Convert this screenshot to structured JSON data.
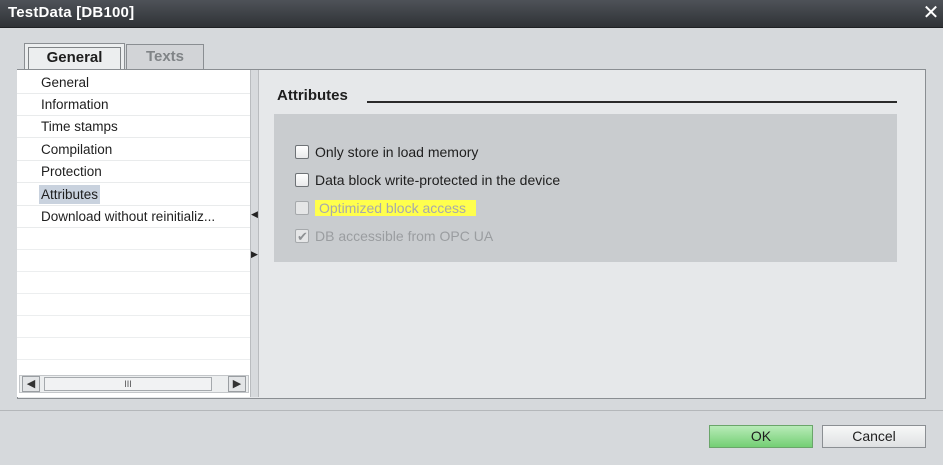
{
  "window": {
    "title": "TestData [DB100]",
    "close_icon": "close-icon"
  },
  "tabs": [
    {
      "label": "General",
      "active": true
    },
    {
      "label": "Texts",
      "active": false
    }
  ],
  "nav": {
    "items": [
      {
        "label": "General",
        "selected": false
      },
      {
        "label": "Information",
        "selected": false
      },
      {
        "label": "Time stamps",
        "selected": false
      },
      {
        "label": "Compilation",
        "selected": false
      },
      {
        "label": "Protection",
        "selected": false
      },
      {
        "label": "Attributes",
        "selected": true
      },
      {
        "label": "Download without reinitializ...",
        "selected": false
      }
    ],
    "scrollbar": {
      "left_icon": "scroll-left-icon",
      "right_icon": "scroll-right-icon",
      "thumb_grip": "III"
    }
  },
  "attributes": {
    "title": "Attributes",
    "options": [
      {
        "label": "Only store in load memory",
        "checked": false,
        "enabled": true,
        "highlighted": false
      },
      {
        "label": "Data block write-protected in the device",
        "checked": false,
        "enabled": true,
        "highlighted": false
      },
      {
        "label": "Optimized block access",
        "checked": false,
        "enabled": false,
        "highlighted": true
      },
      {
        "label": "DB accessible from OPC UA",
        "checked": true,
        "enabled": false,
        "highlighted": false
      }
    ]
  },
  "footer": {
    "ok_label": "OK",
    "cancel_label": "Cancel"
  },
  "colors": {
    "title_bar": "#3b3e42",
    "highlight": "#ffff4d",
    "ok_button": "#8fdc8f",
    "selected_item": "#c9d2de"
  }
}
